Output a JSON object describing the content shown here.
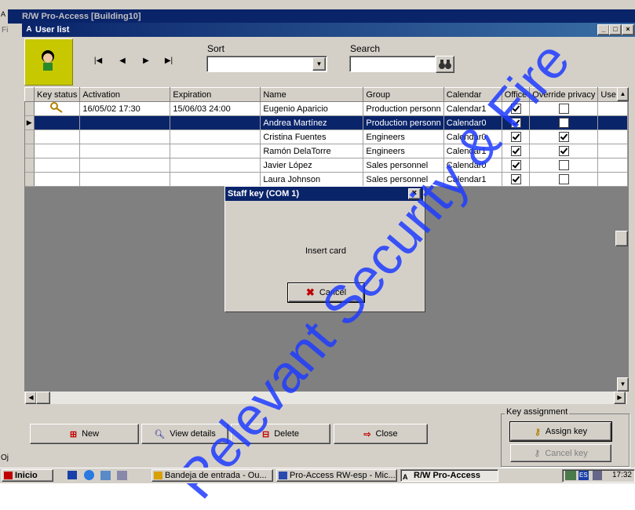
{
  "app": {
    "title": "R/W Pro-Access [Building10]",
    "menu_fragment": "Fi",
    "left_fragment": "Oj"
  },
  "child_window": {
    "title": "User list"
  },
  "toolbar": {
    "sort_label": "Sort",
    "sort_value": "",
    "search_label": "Search",
    "search_value": ""
  },
  "grid": {
    "columns": [
      "Key status",
      "Activation",
      "Expiration",
      "Name",
      "Group",
      "Calendar",
      "Office",
      "Override privacy",
      "Use e"
    ],
    "rows": [
      {
        "key_status": "key",
        "activation": "16/05/02 17:30",
        "expiration": "15/06/03 24:00",
        "name": "Eugenio Aparicio",
        "group": "Production personn",
        "calendar": "Calendar1",
        "office": true,
        "override": false,
        "selected": false
      },
      {
        "key_status": "",
        "activation": "",
        "expiration": "",
        "name": "Andrea Martínez",
        "group": "Production personn",
        "calendar": "Calendar0",
        "office": true,
        "override": false,
        "selected": true
      },
      {
        "key_status": "",
        "activation": "",
        "expiration": "",
        "name": "Cristina Fuentes",
        "group": "Engineers",
        "calendar": "Calendar0",
        "office": true,
        "override": true,
        "selected": false
      },
      {
        "key_status": "",
        "activation": "",
        "expiration": "",
        "name": "Ramón DelaTorre",
        "group": "Engineers",
        "calendar": "Calendar1",
        "office": true,
        "override": true,
        "selected": false
      },
      {
        "key_status": "",
        "activation": "",
        "expiration": "",
        "name": "Javier López",
        "group": "Sales personnel",
        "calendar": "Calendar0",
        "office": true,
        "override": false,
        "selected": false
      },
      {
        "key_status": "",
        "activation": "",
        "expiration": "",
        "name": "Laura Johnson",
        "group": "Sales personnel",
        "calendar": "Calendar1",
        "office": true,
        "override": false,
        "selected": false
      }
    ]
  },
  "dialog": {
    "title": "Staff key (COM 1)",
    "message": "Insert card",
    "cancel_label": "Cancel"
  },
  "actions": {
    "new_label": "New",
    "view_label": "View details",
    "delete_label": "Delete",
    "close_label": "Close"
  },
  "key_assignment": {
    "group_label": "Key assignment",
    "assign_label": "Assign key",
    "cancel_label": "Cancel key"
  },
  "taskbar": {
    "start_label": "Inicio",
    "tasks": [
      "Bandeja de entrada - Ou...",
      "Pro-Access RW-esp - Mic...",
      "R/W Pro-Access"
    ],
    "lang": "ES",
    "time": "17:32"
  },
  "watermark": "Relevant Security & Fire",
  "colors": {
    "title_bar": "#0a246a",
    "selection": "#0a246a",
    "face": "#d4d0c8",
    "user_icon_bg": "#c8c800",
    "watermark": "#1f3cff"
  }
}
